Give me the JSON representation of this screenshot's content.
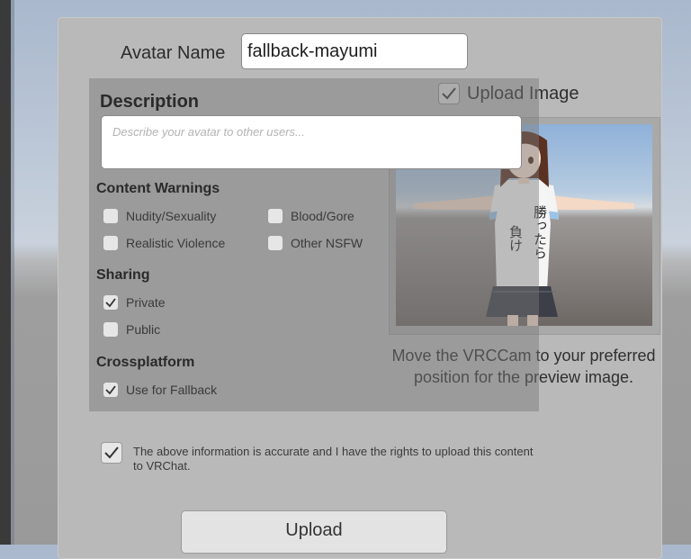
{
  "form": {
    "avatar_name_label": "Avatar Name",
    "avatar_name_value": "fallback-mayumi",
    "upload_image_label": "Upload Image",
    "upload_image_checked": true,
    "description_title": "Description",
    "description_placeholder": "Describe your avatar to other users...",
    "preview_caption": "Move the VRCCam to your preferred position for the preview image.",
    "preview_shirt_text": "勝ったら負け",
    "content_warnings": {
      "title": "Content Warnings",
      "options": [
        {
          "label": "Nudity/Sexuality",
          "checked": false
        },
        {
          "label": "Blood/Gore",
          "checked": false
        },
        {
          "label": "Realistic Violence",
          "checked": false
        },
        {
          "label": "Other NSFW",
          "checked": false
        }
      ]
    },
    "sharing": {
      "title": "Sharing",
      "options": [
        {
          "label": "Private",
          "checked": true
        },
        {
          "label": "Public",
          "checked": false
        }
      ]
    },
    "crossplatform": {
      "title": "Crossplatform",
      "options": [
        {
          "label": "Use for Fallback",
          "checked": true
        }
      ]
    },
    "confirm_text": "The above information is accurate and I have the rights to upload this content to VRChat.",
    "confirm_checked": true,
    "upload_button_label": "Upload"
  }
}
